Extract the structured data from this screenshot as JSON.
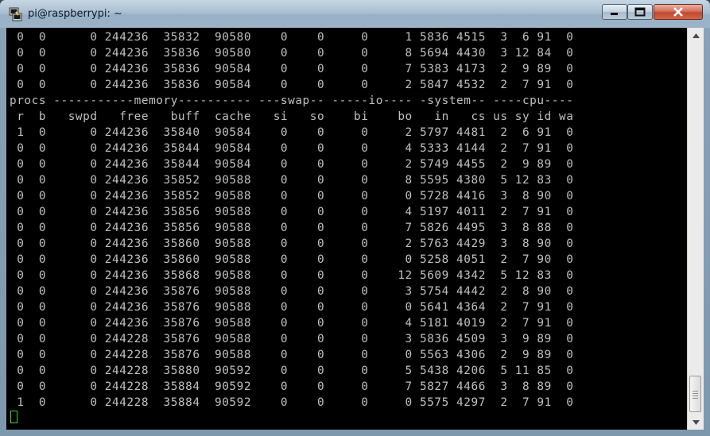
{
  "window": {
    "title": "pi@raspberrypi: ~"
  },
  "icons": {
    "app": "putty-terminal-icon",
    "minimize": "minimize-icon",
    "maximize": "maximize-icon",
    "close": "close-icon",
    "scroll_up": "arrow-up-icon",
    "scroll_down": "arrow-down-icon"
  },
  "colors": {
    "terminal_bg": "#000000",
    "terminal_fg": "#c0c0c0",
    "cursor": "#39d239"
  },
  "terminal": {
    "lines": [
      " 0  0      0 244236  35832  90580    0    0     0     1 5836 4515  3  6 91  0",
      " 0  0      0 244236  35836  90580    0    0     0     8 5694 4430  3 12 84  0",
      " 0  0      0 244236  35836  90584    0    0     0     7 5383 4173  2  9 89  0",
      " 0  0      0 244236  35836  90584    0    0     0     2 5847 4532  2  7 91  0",
      "procs -----------memory---------- ---swap-- -----io---- -system-- ----cpu----",
      " r  b   swpd   free   buff  cache   si   so    bi    bo   in   cs us sy id wa",
      " 1  0      0 244236  35840  90584    0    0     0     2 5797 4481  2  6 91  0",
      " 0  0      0 244236  35844  90584    0    0     0     4 5333 4144  2  7 91  0",
      " 0  0      0 244236  35844  90584    0    0     0     2 5749 4455  2  9 89  0",
      " 0  0      0 244236  35852  90588    0    0     0     8 5595 4380  5 12 83  0",
      " 0  0      0 244236  35852  90588    0    0     0     0 5728 4416  3  8 90  0",
      " 0  0      0 244236  35856  90588    0    0     0     4 5197 4011  2  7 91  0",
      " 0  0      0 244236  35856  90588    0    0     0     7 5826 4495  3  8 88  0",
      " 0  0      0 244236  35860  90588    0    0     0     2 5763 4429  3  8 90  0",
      " 0  0      0 244236  35860  90588    0    0     0     0 5258 4051  2  7 90  0",
      " 0  0      0 244236  35868  90588    0    0     0    12 5609 4342  5 12 83  0",
      " 0  0      0 244236  35876  90588    0    0     0     3 5754 4442  2  8 90  0",
      " 0  0      0 244236  35876  90588    0    0     0     0 5641 4364  2  7 91  0",
      " 0  0      0 244236  35876  90588    0    0     0     4 5181 4019  2  7 91  0",
      " 0  0      0 244228  35876  90588    0    0     0     3 5836 4509  3  9 89  0",
      " 0  0      0 244228  35876  90588    0    0     0     0 5563 4306  2  9 89  0",
      " 0  0      0 244228  35880  90592    0    0     0     5 5438 4206  5 11 85  0",
      " 0  0      0 244228  35884  90592    0    0     0     7 5827 4466  3  8 89  0",
      " 1  0      0 244228  35884  90592    0    0     0     0 5575 4297  2  7 91  0"
    ]
  }
}
